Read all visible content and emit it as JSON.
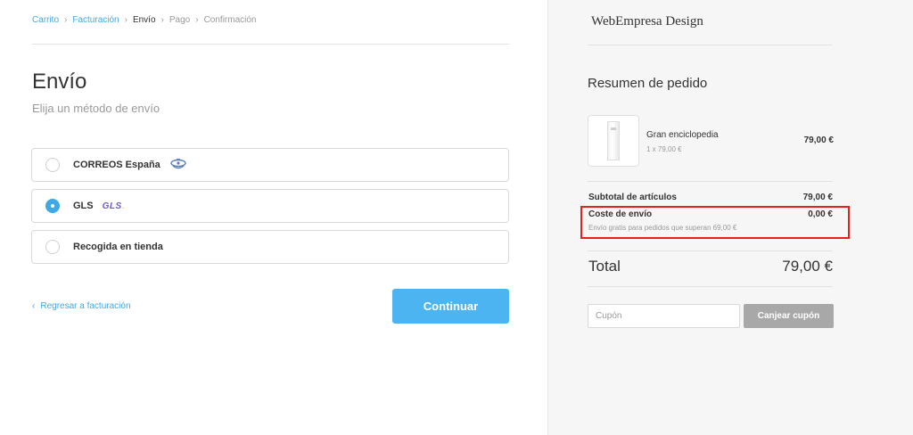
{
  "breadcrumb": {
    "items": [
      {
        "label": "Carrito",
        "state": "link"
      },
      {
        "label": "Facturación",
        "state": "link"
      },
      {
        "label": "Envío",
        "state": "current"
      },
      {
        "label": "Pago",
        "state": "inactive"
      },
      {
        "label": "Confirmación",
        "state": "inactive"
      }
    ],
    "separator": "›"
  },
  "main": {
    "title": "Envío",
    "subtitle": "Elija un método de envío",
    "shipping_options": [
      {
        "label": "CORREOS España",
        "icon": "correos-horn-icon",
        "selected": false
      },
      {
        "label": "GLS",
        "icon": "gls-logo",
        "logo_text": "GLS",
        "selected": true
      },
      {
        "label": "Recogida en tienda",
        "icon": null,
        "selected": false
      }
    ],
    "back_link": "Regresar a facturación",
    "back_arrow": "‹",
    "continue_button": "Continuar"
  },
  "summary": {
    "store_name": "WebEmpresa Design",
    "title": "Resumen de pedido",
    "product": {
      "name": "Gran enciclopedia",
      "qty": "1 x 79,00 €",
      "price": "79,00 €"
    },
    "subtotal_label": "Subtotal de artículos",
    "subtotal_value": "79,00 €",
    "shipping_label": "Coste de envío",
    "shipping_value": "0,00 €",
    "shipping_note": "Envío gratis para pedidos que superan 69,00 €",
    "total_label": "Total",
    "total_value": "79,00 €",
    "coupon_placeholder": "Cupón",
    "coupon_button": "Canjear cupón"
  },
  "colors": {
    "accent": "#3fa8e5",
    "button": "#4cb4f0",
    "highlight": "#e0231b",
    "panel_bg": "#f6f6f6"
  }
}
